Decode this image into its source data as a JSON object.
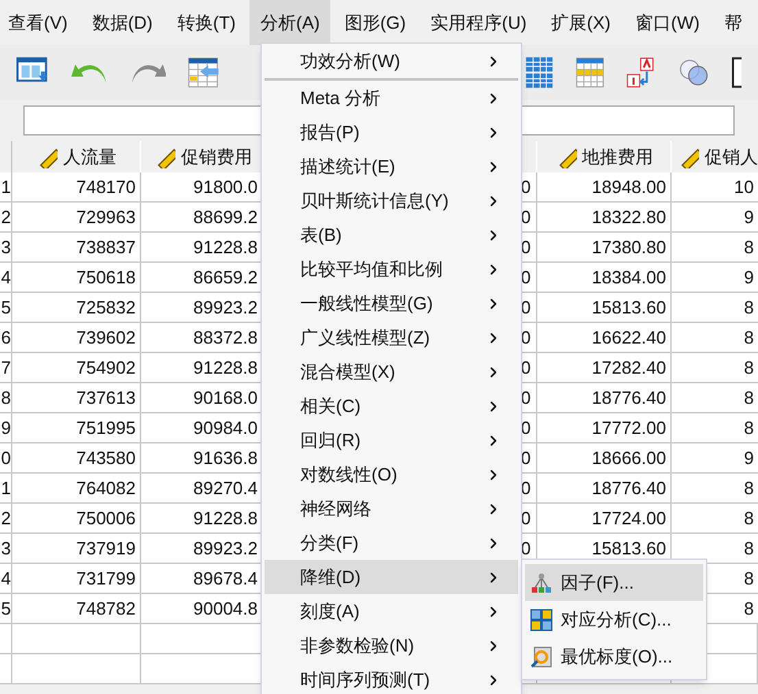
{
  "menu_bar": [
    {
      "label": "查看(V)",
      "selected": false
    },
    {
      "label": "数据(D)",
      "selected": false
    },
    {
      "label": "转换(T)",
      "selected": false
    },
    {
      "label": "分析(A)",
      "selected": true
    },
    {
      "label": "图形(G)",
      "selected": false
    },
    {
      "label": "实用程序(U)",
      "selected": false
    },
    {
      "label": "扩展(X)",
      "selected": false
    },
    {
      "label": "窗口(W)",
      "selected": false
    },
    {
      "label": "帮",
      "selected": false
    }
  ],
  "table": {
    "columns": [
      {
        "label": "人流量"
      },
      {
        "label": "促销费用"
      },
      {
        "label": "地推费用"
      },
      {
        "label": "促销人"
      }
    ],
    "rows": [
      {
        "row_number": "1",
        "visitors": "748170",
        "promo_cost": "91800.0",
        "column_3": "0",
        "ground_cost": "18948.00",
        "promoters": "10"
      },
      {
        "row_number": "2",
        "visitors": "729963",
        "promo_cost": "88699.2",
        "column_3": "0",
        "ground_cost": "18322.80",
        "promoters": "9"
      },
      {
        "row_number": "3",
        "visitors": "738837",
        "promo_cost": "91228.8",
        "column_3": "0",
        "ground_cost": "17380.80",
        "promoters": "8"
      },
      {
        "row_number": "4",
        "visitors": "750618",
        "promo_cost": "86659.2",
        "column_3": "0",
        "ground_cost": "18384.00",
        "promoters": "9"
      },
      {
        "row_number": "5",
        "visitors": "725832",
        "promo_cost": "89923.2",
        "column_3": "0",
        "ground_cost": "15813.60",
        "promoters": "8"
      },
      {
        "row_number": "6",
        "visitors": "739602",
        "promo_cost": "88372.8",
        "column_3": "0",
        "ground_cost": "16622.40",
        "promoters": "8"
      },
      {
        "row_number": "7",
        "visitors": "754902",
        "promo_cost": "91228.8",
        "column_3": "0",
        "ground_cost": "17282.40",
        "promoters": "8"
      },
      {
        "row_number": "8",
        "visitors": "737613",
        "promo_cost": "90168.0",
        "column_3": "0",
        "ground_cost": "18776.40",
        "promoters": "8"
      },
      {
        "row_number": "9",
        "visitors": "751995",
        "promo_cost": "90984.0",
        "column_3": "0",
        "ground_cost": "17772.00",
        "promoters": "8"
      },
      {
        "row_number": "0",
        "visitors": "743580",
        "promo_cost": "91636.8",
        "column_3": "0",
        "ground_cost": "18666.00",
        "promoters": "9"
      },
      {
        "row_number": "1",
        "visitors": "764082",
        "promo_cost": "89270.4",
        "column_3": "0",
        "ground_cost": "18776.40",
        "promoters": "8"
      },
      {
        "row_number": "2",
        "visitors": "750006",
        "promo_cost": "91228.8",
        "column_3": "0",
        "ground_cost": "17724.00",
        "promoters": "8"
      },
      {
        "row_number": "3",
        "visitors": "737919",
        "promo_cost": "89923.2",
        "column_3": "0",
        "ground_cost": "15813.60",
        "promoters": "8"
      },
      {
        "row_number": "4",
        "visitors": "731799",
        "promo_cost": "89678.4",
        "promoters": "8"
      },
      {
        "row_number": "5",
        "visitors": "748782",
        "promo_cost": "90004.8",
        "promoters": "8"
      }
    ]
  },
  "analyze_menu": {
    "sections": [
      {
        "items": [
          {
            "label": "功效分析(W)",
            "selected": false
          }
        ]
      },
      {
        "items": [
          {
            "label": "Meta 分析",
            "selected": false
          },
          {
            "label": "报告(P)",
            "selected": false
          },
          {
            "label": "描述统计(E)",
            "selected": false
          },
          {
            "label": "贝叶斯统计信息(Y)",
            "selected": false
          },
          {
            "label": "表(B)",
            "selected": false
          },
          {
            "label": "比较平均值和比例",
            "selected": false
          },
          {
            "label": "一般线性模型(G)",
            "selected": false
          },
          {
            "label": "广义线性模型(Z)",
            "selected": false
          },
          {
            "label": "混合模型(X)",
            "selected": false
          },
          {
            "label": "相关(C)",
            "selected": false
          },
          {
            "label": "回归(R)",
            "selected": false
          },
          {
            "label": "对数线性(O)",
            "selected": false
          },
          {
            "label": "神经网络",
            "selected": false
          },
          {
            "label": "分类(F)",
            "selected": false
          },
          {
            "label": "降维(D)",
            "selected": true
          },
          {
            "label": "刻度(A)",
            "selected": false
          },
          {
            "label": "非参数检验(N)",
            "selected": false
          },
          {
            "label": "时间序列预测(T)",
            "selected": false
          }
        ]
      }
    ]
  },
  "submenu": {
    "items": [
      {
        "label": "因子(F)...",
        "selected": true,
        "kind": "factor"
      },
      {
        "label": "对应分析(C)...",
        "selected": false,
        "kind": "correspondence"
      },
      {
        "label": "最优标度(O)...",
        "selected": false,
        "kind": "scaling"
      }
    ]
  }
}
